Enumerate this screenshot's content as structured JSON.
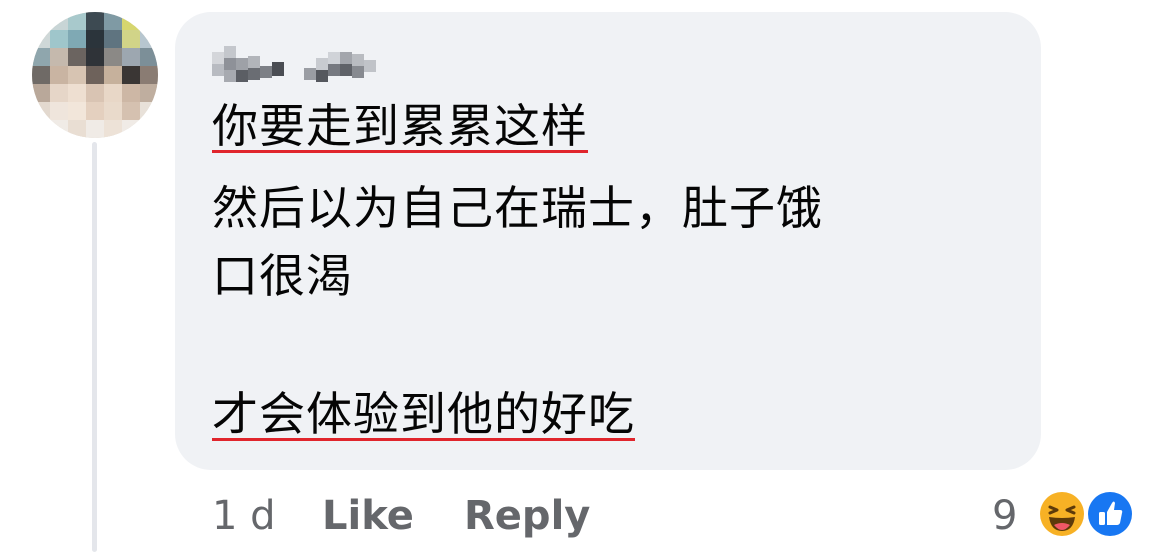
{
  "comment": {
    "author": "",
    "lines": [
      "你要走到累累这样",
      "然后以为自己在瑞士，肚子饿",
      "口很渴",
      "才会体验到他的好吃"
    ]
  },
  "actions": {
    "time": "1 d",
    "like": "Like",
    "reply": "Reply"
  },
  "reactions": {
    "count": "9",
    "icons": [
      "haha-icon",
      "like-icon"
    ]
  },
  "colors": {
    "bubble": "#f0f2f5",
    "underline": "#e0252c",
    "meta_text": "#65676b",
    "like_blue": "#1877f2",
    "haha_yellow": "#f7b125"
  }
}
